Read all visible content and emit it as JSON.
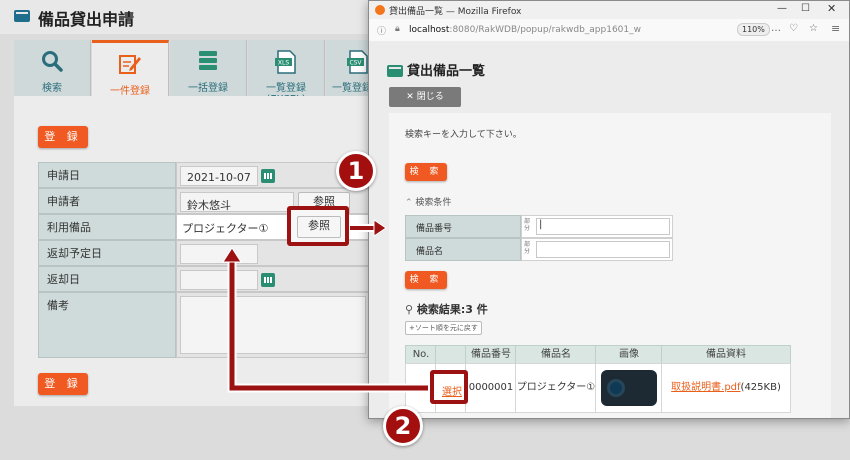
{
  "main": {
    "title": "備品貸出申請",
    "tabs": [
      {
        "label": "検索"
      },
      {
        "label": "一件登録"
      },
      {
        "label": "一括登録"
      },
      {
        "label": "一覧登録(EXCEL)"
      },
      {
        "label": "一覧登録("
      }
    ],
    "tab_icon_text": {
      "xls": "XLS",
      "csv": "CSV"
    },
    "register_label": "登 録",
    "form": {
      "apply_date_label": "申請日",
      "apply_date_value": "2021-10-07",
      "applicant_label": "申請者",
      "applicant_value": "鈴木悠斗",
      "applicant_ref": "参照",
      "equipment_label": "利用備品",
      "equipment_value": "プロジェクター①",
      "equipment_ref": "参照",
      "return_plan_label": "返却予定日",
      "return_date_label": "返却日",
      "note_label": "備考"
    }
  },
  "popup": {
    "window_title": "貸出備品一覧 — Mozilla Firefox",
    "url_host": "localhost",
    "url_rest": ":8080/RakWDB/popup/rakwdb_app1601_w",
    "zoom": "110%",
    "heading": "貸出備品一覧",
    "close_label": "✕ 閉じる",
    "hint": "検索キーを入力して下さい。",
    "search_label": "検 索",
    "conditions_label": "検索条件",
    "fields": [
      {
        "label": "備品番号",
        "note": "部分"
      },
      {
        "label": "備品名",
        "note": "部分"
      }
    ],
    "results_label": "検索結果:3 件",
    "reset_sort_label": "+ソート順を元に戻す",
    "columns": [
      "No.",
      "",
      "備品番号",
      "備品名",
      "画像",
      "備品資料"
    ],
    "row": {
      "select": "選択",
      "number": "0000001",
      "name": "プロジェクター①",
      "doc_link": "取扱説明書.pdf",
      "doc_size": "(425KB)"
    }
  },
  "callouts": {
    "one": "1",
    "two": "2"
  },
  "colors": {
    "accent": "#f05a22",
    "teal": "#2a6e7c",
    "marker": "#a30f0f"
  }
}
